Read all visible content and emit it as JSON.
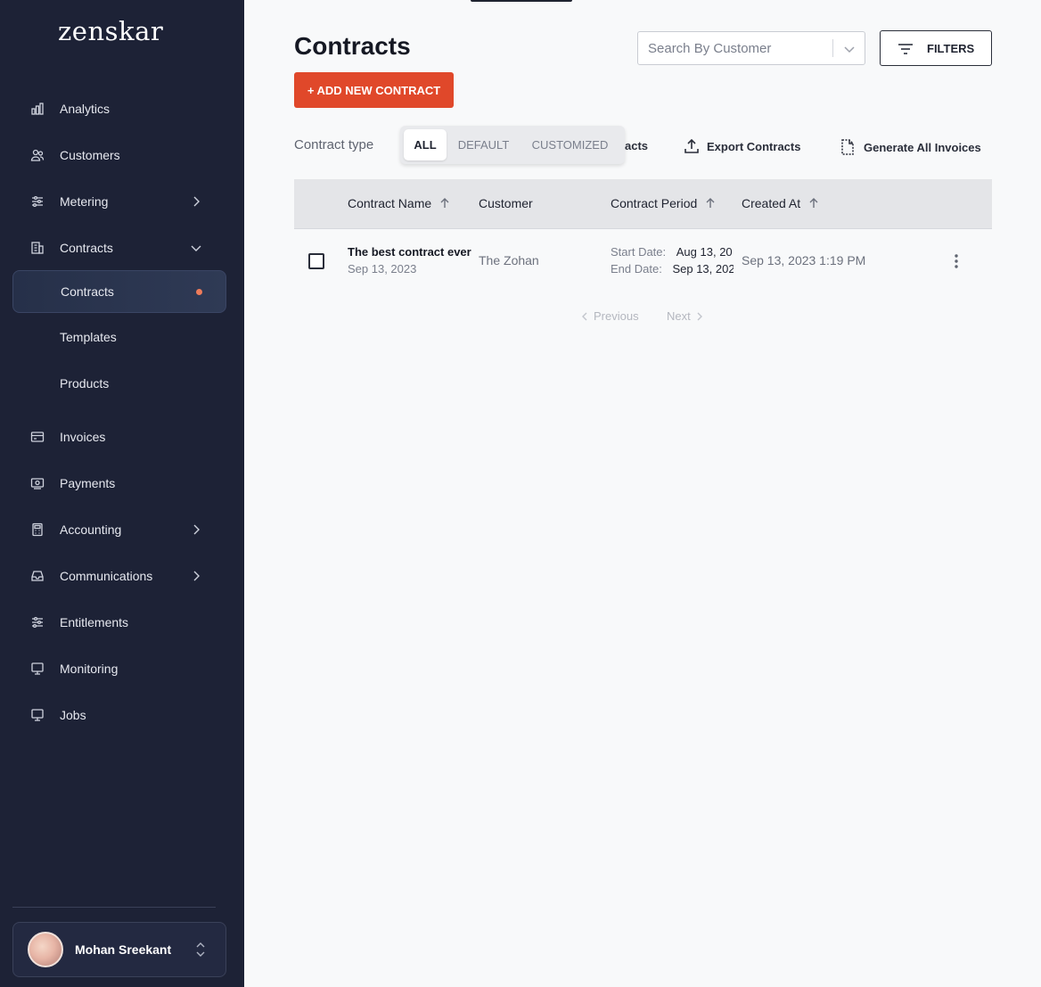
{
  "brand": {
    "logo": "zenskar"
  },
  "sidebar": {
    "items": [
      {
        "label": "Analytics",
        "icon": "bar-chart-icon"
      },
      {
        "label": "Customers",
        "icon": "users-icon"
      },
      {
        "label": "Metering",
        "icon": "sliders-icon",
        "chevron": "right"
      },
      {
        "label": "Contracts",
        "icon": "building-icon",
        "chevron": "down"
      },
      {
        "label": "Contracts",
        "active": true,
        "indicator": "#ee7b5a"
      },
      {
        "label": "Templates"
      },
      {
        "label": "Products"
      },
      {
        "label": "Invoices",
        "icon": "card-icon"
      },
      {
        "label": "Payments",
        "icon": "payment-icon"
      },
      {
        "label": "Accounting",
        "icon": "calculator-icon",
        "chevron": "right"
      },
      {
        "label": "Communications",
        "icon": "inbox-icon",
        "chevron": "right"
      },
      {
        "label": "Entitlements",
        "icon": "sliders-icon"
      },
      {
        "label": "Monitoring",
        "icon": "monitor-icon"
      },
      {
        "label": "Jobs",
        "icon": "monitor-icon"
      }
    ],
    "user": {
      "name": "Mohan Sreekant"
    }
  },
  "header": {
    "title": "Contracts",
    "search_placeholder": "Search By Customer",
    "filters_label": "FILTERS",
    "add_button": "+ ADD NEW CONTRACT"
  },
  "toolbar": {
    "contract_type_label": "Contract type",
    "segments": [
      "ALL",
      "DEFAULT",
      "CUSTOMIZED"
    ],
    "selected_segment": "ALL",
    "hidden_action_fragment": "acts",
    "export_label": "Export Contracts",
    "generate_label": "Generate All Invoices"
  },
  "table": {
    "columns": [
      "Contract Name",
      "Customer",
      "Contract Period",
      "Created At"
    ],
    "rows": [
      {
        "name": "The best contract ever",
        "date": "Sep 13, 2023",
        "customer": "The Zohan",
        "start_label": "Start Date:",
        "start_value": "Aug 13, 20",
        "end_label": "End Date:",
        "end_value": "Sep 13, 202",
        "created": "Sep 13, 2023 1:19 PM"
      }
    ]
  },
  "pagination": {
    "previous": "Previous",
    "next": "Next"
  },
  "colors": {
    "sidebar_bg": "#1d2236",
    "accent": "#e0482a",
    "active_dot": "#ee7b5a"
  }
}
